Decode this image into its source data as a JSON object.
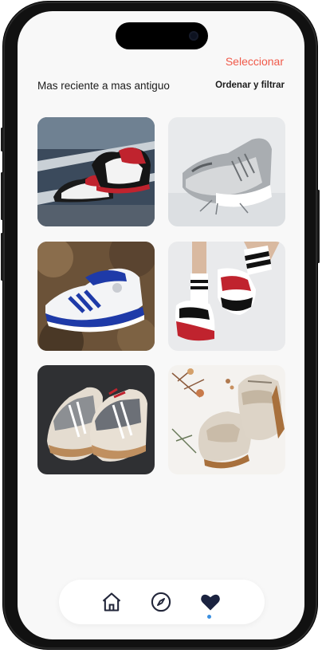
{
  "header": {
    "select_label": "Seleccionar",
    "sort_title": "Mas reciente a mas antiguo",
    "filter_label": "Ordenar y filtrar"
  },
  "products": [
    {
      "image": "red-black-high-top-sneakers-on-track"
    },
    {
      "image": "grey-white-running-sneaker"
    },
    {
      "image": "white-blue-adidas-sneakers-on-rocks"
    },
    {
      "image": "legs-wearing-red-black-sneakers-and-striped-socks"
    },
    {
      "image": "grey-suede-sneakers-on-dark-background"
    },
    {
      "image": "beige-high-top-sneakers-with-dried-flowers"
    }
  ],
  "tabbar": {
    "items": [
      {
        "icon": "home-icon",
        "active": false
      },
      {
        "icon": "compass-icon",
        "active": false
      },
      {
        "icon": "heart-icon",
        "active": true
      }
    ],
    "active_indicator_color": "#3a8fe0"
  },
  "colors": {
    "accent": "#f05a4a",
    "background": "#f8f8f8",
    "text": "#1b1b1b"
  }
}
